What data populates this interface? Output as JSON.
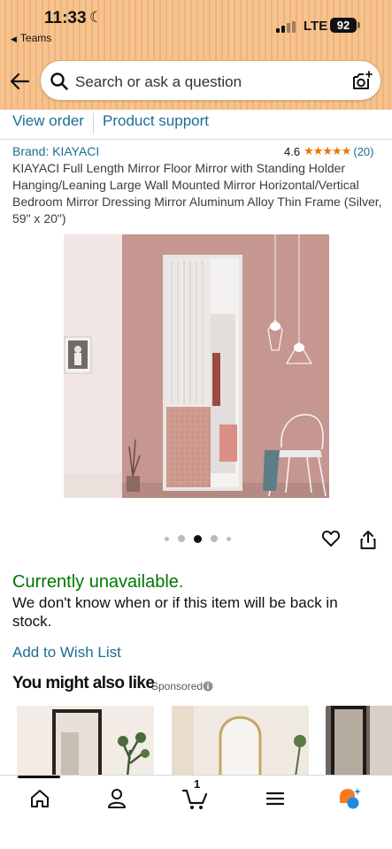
{
  "status_bar": {
    "time": "11:33",
    "moon": "☾",
    "back_app": "Teams",
    "network": "LTE",
    "battery": "92"
  },
  "search": {
    "placeholder": "Search or ask a question"
  },
  "links": {
    "view_order": "View order",
    "product_support": "Product support"
  },
  "product": {
    "brand": "Brand: KIAYACI",
    "rating": "4.6",
    "stars": "★★★★★",
    "review_count": "(20)",
    "title": "KIAYACI Full Length Mirror Floor Mirror with Standing Holder Hanging/Leaning Large Wall Mounted Mirror Horizontal/Vertical Bedroom Mirror Dressing Mirror Aluminum Alloy Thin Frame (Silver, 59\" x 20\")",
    "image_count": 5,
    "active_image_index": 2
  },
  "availability": {
    "status": "Currently unavailable.",
    "message": "We don't know when or if this item will be back in stock."
  },
  "actions": {
    "add_to_wish_list": "Add to Wish List"
  },
  "recommendations": {
    "heading": "You might also like",
    "sponsored_label": "Sponsored"
  },
  "nav": {
    "cart_count": "1",
    "items": [
      "home-icon",
      "account-icon",
      "cart-icon",
      "menu-icon",
      "rufus-icon"
    ]
  },
  "colors": {
    "header_bg": "#f6c38e",
    "link": "#1d6d93",
    "star": "#e77600",
    "available_status": "#007600",
    "rufus_orange": "#f47c20",
    "rufus_blue": "#1a8ae6"
  }
}
